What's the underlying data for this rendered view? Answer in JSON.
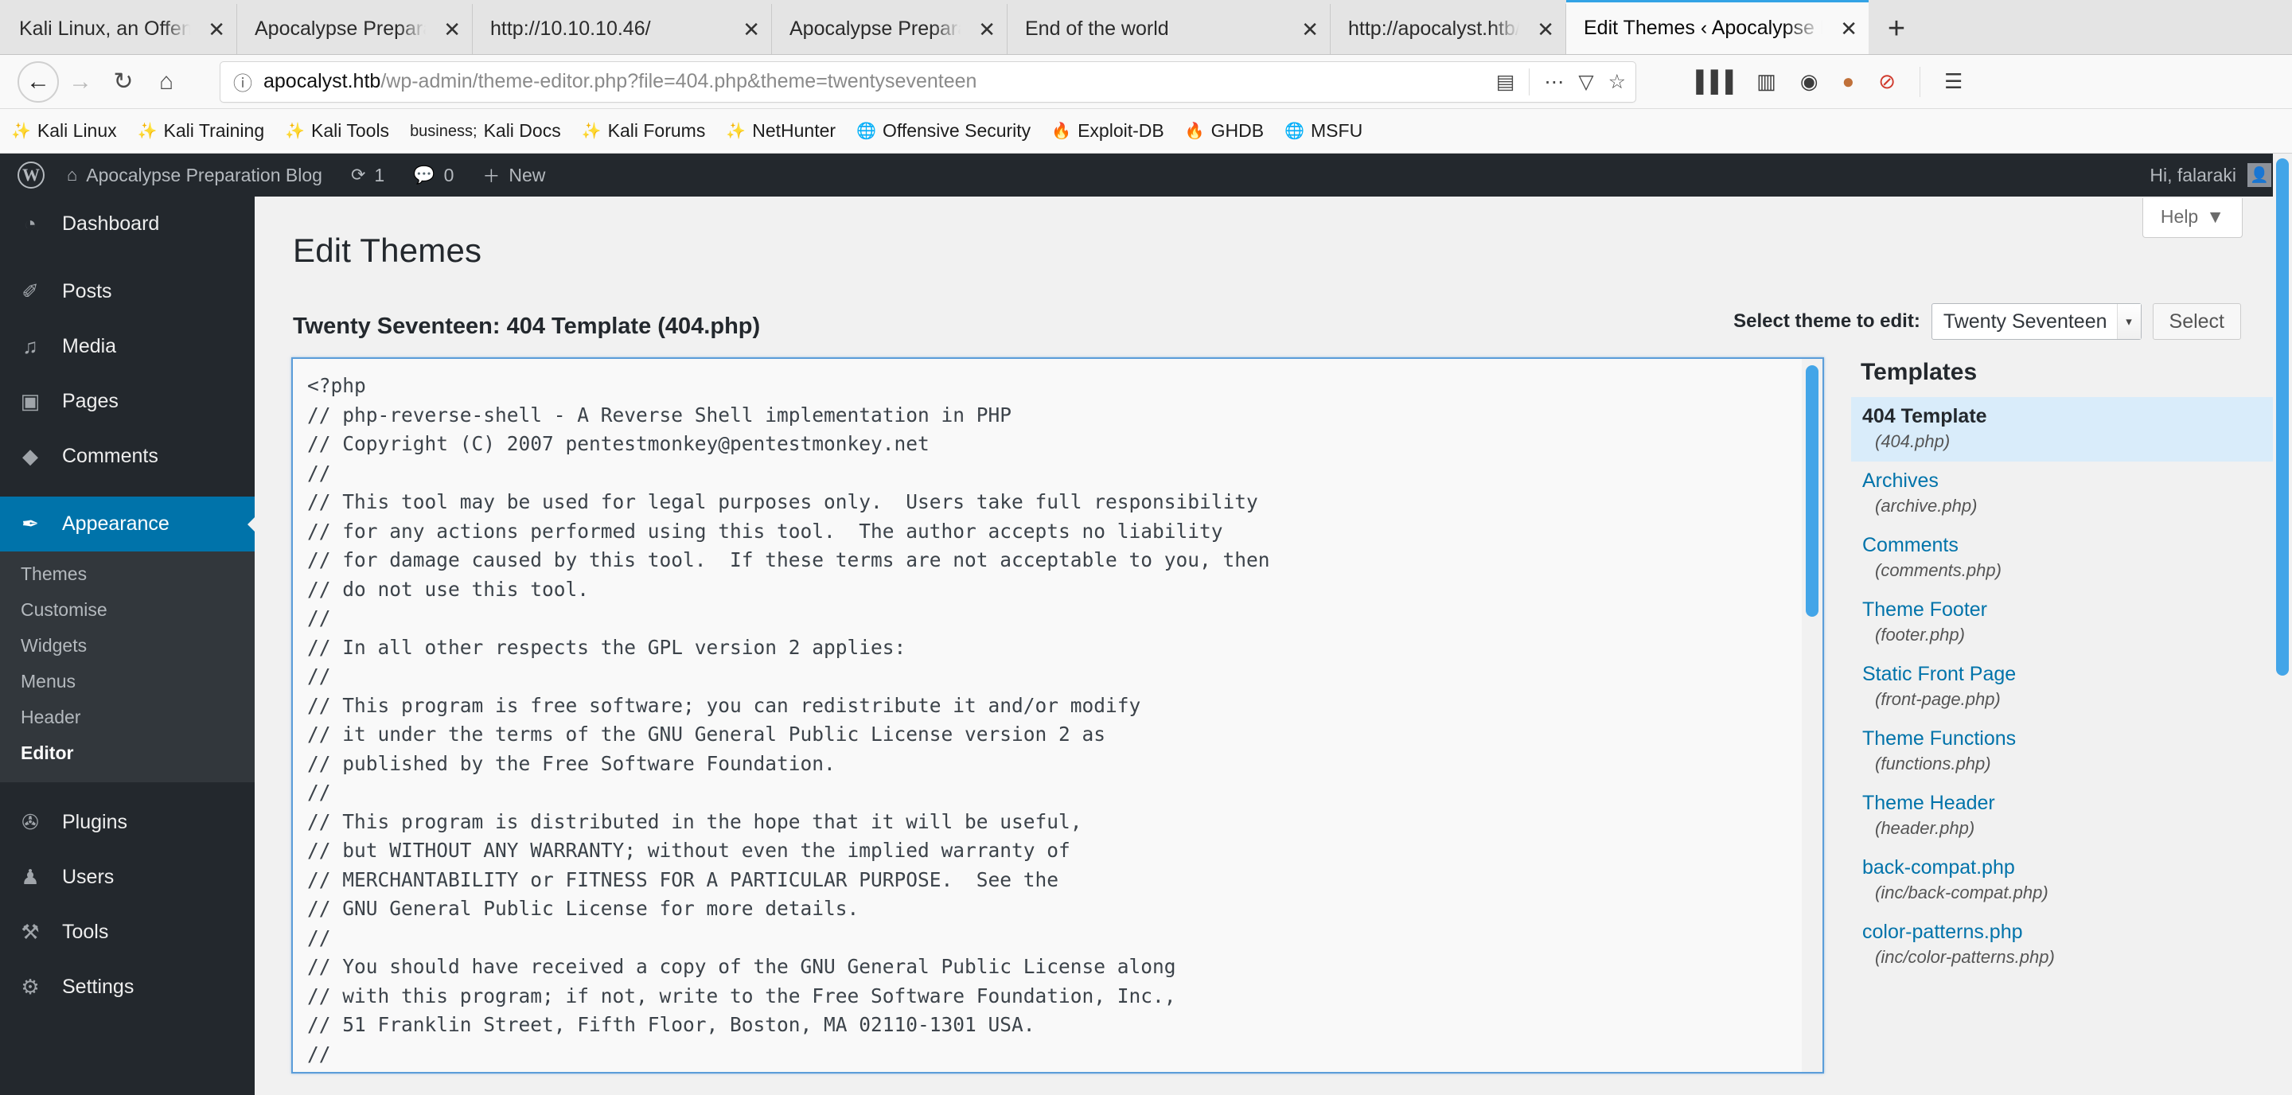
{
  "browser": {
    "tabs": [
      {
        "title": "Kali Linux, an Offensive Sec",
        "close": "✕",
        "active": false
      },
      {
        "title": "Apocalypse Preparation Bl",
        "close": "✕",
        "active": false
      },
      {
        "title": "http://10.10.10.46/",
        "close": "✕",
        "active": false
      },
      {
        "title": "Apocalypse Preparation Bl",
        "close": "✕",
        "active": false
      },
      {
        "title": "End of the world",
        "close": "✕",
        "active": false
      },
      {
        "title": "http://apocalyst.htb/Righti",
        "close": "✕",
        "active": false
      },
      {
        "title": "Edit Themes ‹ Apocalypse F",
        "close": "✕",
        "active": true
      }
    ],
    "new_tab_label": "+",
    "nav": {
      "back": "←",
      "forward": "→",
      "reload": "↻",
      "home": "⌂"
    },
    "url": {
      "host": "apocalyst.htb",
      "path": "/wp-admin/theme-editor.php?file=404.php&theme=twentyseventeen",
      "identity_icon": "ⓘ",
      "reader_icon": "▤",
      "more_icon": "⋯",
      "pocket_icon": "▽",
      "bookmark_icon": "☆"
    },
    "toolbar_right": {
      "library_icon": "▐▐▐",
      "sidebar_icon": "▥",
      "account_icon": "◉",
      "cookie_icon": "●",
      "noscript_icon": "⊘",
      "menu_icon": "☰"
    },
    "bookmarks": [
      {
        "label": "Kali Linux",
        "icon": "dragon"
      },
      {
        "label": "Kali Training",
        "icon": "dragon"
      },
      {
        "label": "Kali Tools",
        "icon": "dragon"
      },
      {
        "label": "Kali Docs",
        "icon": "globe"
      },
      {
        "label": "Kali Forums",
        "icon": "dragon"
      },
      {
        "label": "NetHunter",
        "icon": "dragon"
      },
      {
        "label": "Offensive Security",
        "icon": "globe"
      },
      {
        "label": "Exploit-DB",
        "icon": "flame"
      },
      {
        "label": "GHDB",
        "icon": "flame"
      },
      {
        "label": "MSFU",
        "icon": "globe"
      }
    ]
  },
  "adminbar": {
    "site_name": "Apocalypse Preparation Blog",
    "updates_count": "1",
    "comments_count": "0",
    "new_label": "New",
    "greeting": "Hi, falaraki",
    "icons": {
      "wp": "W",
      "home": "⌂",
      "updates": "⟳",
      "comments": "◉",
      "new": "＋",
      "avatar": "☻"
    }
  },
  "sidebar": {
    "items": [
      {
        "label": "Dashboard",
        "icon": "◔",
        "current": false
      },
      {
        "label": "Posts",
        "icon": "✐",
        "current": false
      },
      {
        "label": "Media",
        "icon": "♫",
        "current": false
      },
      {
        "label": "Pages",
        "icon": "▣",
        "current": false
      },
      {
        "label": "Comments",
        "icon": "◆",
        "current": false
      },
      {
        "label": "Appearance",
        "icon": "✒",
        "current": true
      },
      {
        "label": "Plugins",
        "icon": "✇",
        "current": false
      },
      {
        "label": "Users",
        "icon": "♟",
        "current": false
      },
      {
        "label": "Tools",
        "icon": "⚒",
        "current": false
      },
      {
        "label": "Settings",
        "icon": "⚙",
        "current": false
      }
    ],
    "submenu": [
      {
        "label": "Themes",
        "current": false
      },
      {
        "label": "Customise",
        "current": false
      },
      {
        "label": "Widgets",
        "current": false
      },
      {
        "label": "Menus",
        "current": false
      },
      {
        "label": "Header",
        "current": false
      },
      {
        "label": "Editor",
        "current": true
      }
    ]
  },
  "main": {
    "help_label": "Help",
    "help_caret": "▼",
    "page_title": "Edit Themes",
    "file_title": "Twenty Seventeen: 404 Template (404.php)",
    "theme_select_label": "Select theme to edit:",
    "theme_selected": "Twenty Seventeen",
    "theme_caret": "▾",
    "select_button": "Select",
    "editor_code": "<?php\n// php-reverse-shell - A Reverse Shell implementation in PHP\n// Copyright (C) 2007 pentestmonkey@pentestmonkey.net\n//\n// This tool may be used for legal purposes only.  Users take full responsibility\n// for any actions performed using this tool.  The author accepts no liability\n// for damage caused by this tool.  If these terms are not acceptable to you, then\n// do not use this tool.\n//\n// In all other respects the GPL version 2 applies:\n//\n// This program is free software; you can redistribute it and/or modify\n// it under the terms of the GNU General Public License version 2 as\n// published by the Free Software Foundation.\n//\n// This program is distributed in the hope that it will be useful,\n// but WITHOUT ANY WARRANTY; without even the implied warranty of\n// MERCHANTABILITY or FITNESS FOR A PARTICULAR PURPOSE.  See the\n// GNU General Public License for more details.\n//\n// You should have received a copy of the GNU General Public License along\n// with this program; if not, write to the Free Software Foundation, Inc.,\n// 51 Franklin Street, Fifth Floor, Boston, MA 02110-1301 USA.\n//\n// This tool may be used for legal purposes only.  Users take full responsibility"
  },
  "templates": {
    "title": "Templates",
    "items": [
      {
        "name": "404 Template",
        "file": "(404.php)",
        "current": true
      },
      {
        "name": "Archives",
        "file": "(archive.php)",
        "current": false
      },
      {
        "name": "Comments",
        "file": "(comments.php)",
        "current": false
      },
      {
        "name": "Theme Footer",
        "file": "(footer.php)",
        "current": false
      },
      {
        "name": "Static Front Page",
        "file": "(front-page.php)",
        "current": false
      },
      {
        "name": "Theme Functions",
        "file": "(functions.php)",
        "current": false
      },
      {
        "name": "Theme Header",
        "file": "(header.php)",
        "current": false
      },
      {
        "name": "back-compat.php",
        "file": "(inc/back-compat.php)",
        "current": false
      },
      {
        "name": "color-patterns.php",
        "file": "(inc/color-patterns.php)",
        "current": false
      }
    ]
  },
  "colors": {
    "wp_admin_dark": "#23282d",
    "wp_blue": "#0073aa",
    "focus_blue": "#5b9dd9",
    "scroll_blue": "#43a5e8",
    "highlight_row": "#d9ecfa"
  }
}
